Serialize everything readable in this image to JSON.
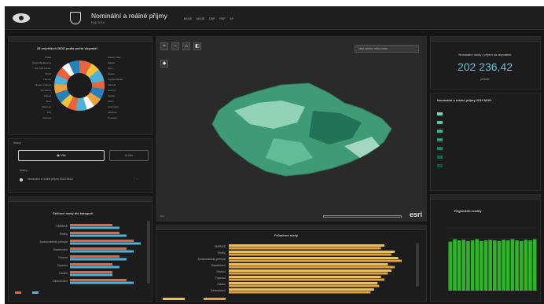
{
  "header": {
    "logo_text": "",
    "title": "Nominální a reálné příjmy",
    "subtitle": "Rok 2016",
    "nav": [
      "MOJE",
      "MOJE",
      "CBP",
      "PDF",
      "EF"
    ]
  },
  "left_top": {
    "title": "25 největších MOÚ podle počtu obyvatel",
    "labels_left": [
      "Praha",
      "České Budějovice",
      "Ústí nad Labem",
      "Plzeň",
      "Liberec",
      "Hradec Králové",
      "Pardubice",
      "Jihlava",
      "Brno",
      "Olomouc",
      "Zlín",
      "Ostrava"
    ],
    "labels_right": [
      "Karlovy Vary",
      "Kladno",
      "Most",
      "Opava",
      "Frýdek-Místek",
      "Karviná",
      "Havířov",
      "Teplice",
      "Děčín",
      "Chomutov",
      "Jablonec",
      "Prostějov"
    ]
  },
  "left_mid": {
    "header": "Vrstvy",
    "btn_left": "Vše",
    "btn_right": "Nic",
    "section": "Vrstvy",
    "layer": "Nominální a reálné příjmy 2016 MOÚ"
  },
  "left_bottom": {
    "header": "",
    "title": "Celkové mzdy dle kategorií",
    "categories": [
      "SMRNSE",
      "Služby",
      "Zpracovatelský průmysl",
      "Stavebnictví",
      "Obchod",
      "Doprava",
      "Ostatní",
      "Zdravotnictví"
    ],
    "series": [
      {
        "name": "2016",
        "values": [
          6,
          7,
          9,
          8,
          7,
          6,
          6,
          8
        ]
      },
      {
        "name": "2016",
        "values": [
          7,
          8,
          10,
          9,
          8,
          7,
          6,
          9
        ]
      }
    ],
    "footer": ""
  },
  "map": {
    "search_placeholder": "Najít adresu nebo místo",
    "attribution": "Esri",
    "esri": "esri",
    "tools": [
      "+",
      "−",
      "⌂",
      "◧"
    ]
  },
  "bottom_center": {
    "header": "",
    "title": "Průměrné mzdy",
    "categories": [
      "SMRNSE",
      "Služby",
      "Zpracovatelský průmysl",
      "Stavebnictví",
      "Obchod",
      "Doprava",
      "Ostatní",
      "Zdravotnictví"
    ],
    "values_a": [
      90,
      96,
      98,
      92,
      94,
      88,
      86,
      84
    ],
    "values_b": [
      88,
      94,
      100,
      96,
      92,
      90,
      87,
      82
    ],
    "legend": [
      "",
      ""
    ]
  },
  "right_top": {
    "header": "",
    "label": "Nominální mzdy / příjem na obyvatele",
    "value": "202 236,42",
    "unit": "průměr"
  },
  "right_mid": {
    "title": "Nominální a reálné příjmy 2016 MOÚ",
    "subtitle": "",
    "legend": [
      "",
      "",
      "",
      "",
      "",
      "",
      ""
    ],
    "colors": [
      "#7fd3b0",
      "#5cc39a",
      "#3fae82",
      "#2e9a6f",
      "#1f845c",
      "#156e4b",
      "#0d593c"
    ]
  },
  "right_bottom": {
    "header": "",
    "title": "Regionální rozdíly",
    "values": [
      78,
      82,
      80,
      81,
      79,
      80,
      82,
      79,
      80,
      81,
      80,
      79,
      81,
      80,
      82,
      80,
      79,
      81,
      80,
      82
    ],
    "y_ticks": [
      "",
      "",
      "",
      "",
      "",
      "",
      ""
    ]
  },
  "colors": {
    "accent": "#5ec2d6",
    "bar_green": "#2fb32b",
    "bar_orange": "#e8643c",
    "bar_yellow": "#f0c33c",
    "bar_teal": "#4fb0d8"
  }
}
